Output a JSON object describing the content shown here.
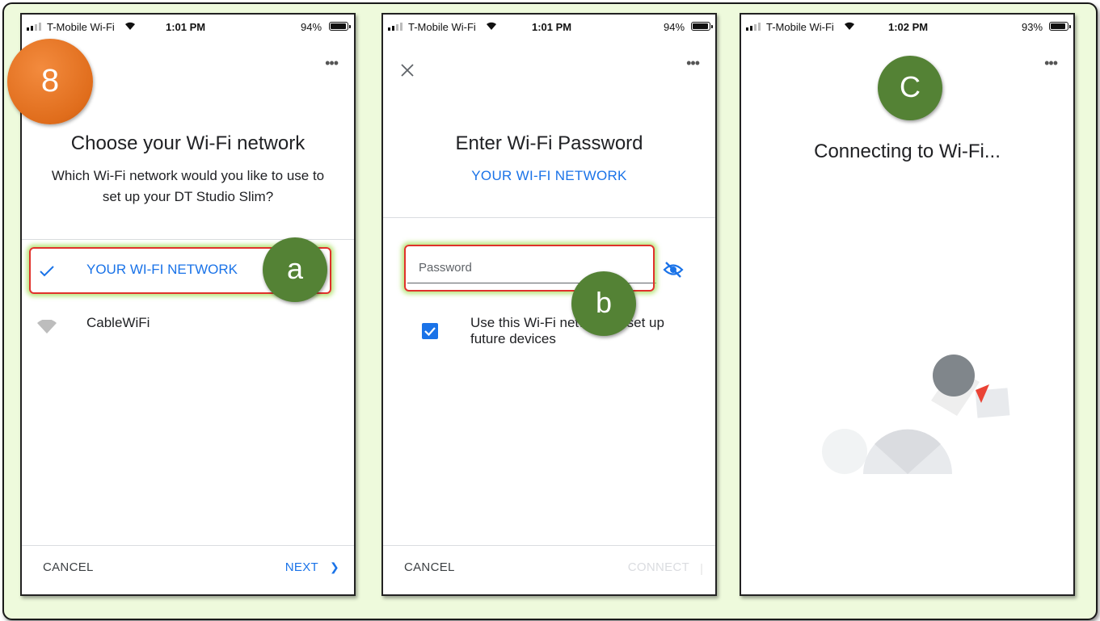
{
  "badge_step": "8",
  "screens": [
    {
      "status": {
        "carrier": "T-Mobile Wi-Fi",
        "time": "1:01 PM",
        "battery": "94%",
        "battery_level": 0.94
      },
      "more_glyph": "•••",
      "title": "Choose your Wi-Fi network",
      "subtitle": "Which Wi-Fi network would you like to use to set up your DT Studio Slim?",
      "networks": [
        {
          "name": "YOUR WI-FI NETWORK",
          "selected": true,
          "icon": "checkmark-icon"
        },
        {
          "name": "CableWiFi",
          "selected": false,
          "icon": "wifi-signal-icon"
        }
      ],
      "badge": "a",
      "cancel": "CANCEL",
      "next": "NEXT",
      "next_glyph": "❯"
    },
    {
      "status": {
        "carrier": "T-Mobile Wi-Fi",
        "time": "1:01 PM",
        "battery": "94%",
        "battery_level": 0.94
      },
      "more_glyph": "•••",
      "title": "Enter Wi-Fi Password",
      "network": "YOUR WI-FI NETWORK",
      "password_placeholder": "Password",
      "remember_checked": true,
      "remember_label": "Use this Wi-Fi network to set up future devices",
      "badge": "b",
      "cancel": "CANCEL",
      "connect": "CONNECT"
    },
    {
      "status": {
        "carrier": "T-Mobile Wi-Fi",
        "time": "1:02 PM",
        "battery": "93%",
        "battery_level": 0.93
      },
      "more_glyph": "•••",
      "badge": "C",
      "title": "Connecting to Wi-Fi..."
    }
  ],
  "colors": {
    "accent_blue": "#1a73e8",
    "badge_green": "#548235",
    "badge_orange": "#e8721f",
    "highlight_red": "#e0312b",
    "frame_bg": "#eefadc"
  }
}
